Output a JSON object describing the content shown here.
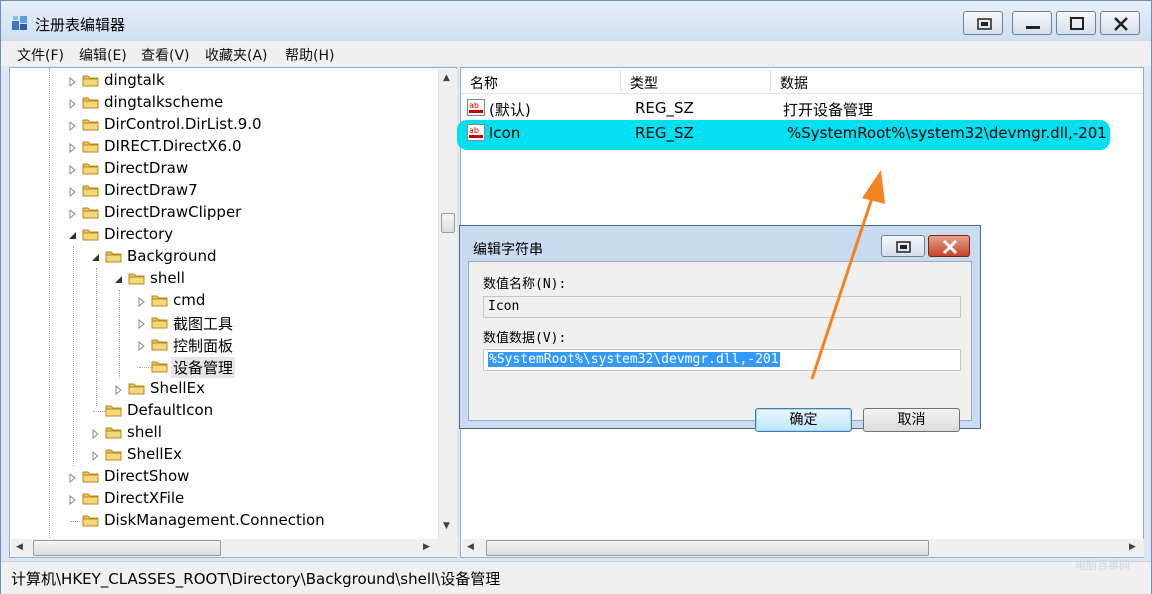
{
  "window": {
    "title": "注册表编辑器",
    "menu": [
      "文件(F)",
      "编辑(E)",
      "查看(V)",
      "收藏夹(A)",
      "帮助(H)"
    ]
  },
  "tree": {
    "items": [
      {
        "label": "dingtalk",
        "depth": 0,
        "expander": "collapsed"
      },
      {
        "label": "dingtalkscheme",
        "depth": 0,
        "expander": "collapsed"
      },
      {
        "label": "DirControl.DirList.9.0",
        "depth": 0,
        "expander": "collapsed"
      },
      {
        "label": "DIRECT.DirectX6.0",
        "depth": 0,
        "expander": "collapsed"
      },
      {
        "label": "DirectDraw",
        "depth": 0,
        "expander": "collapsed"
      },
      {
        "label": "DirectDraw7",
        "depth": 0,
        "expander": "collapsed"
      },
      {
        "label": "DirectDrawClipper",
        "depth": 0,
        "expander": "collapsed"
      },
      {
        "label": "Directory",
        "depth": 0,
        "expander": "expanded"
      },
      {
        "label": "Background",
        "depth": 1,
        "expander": "expanded"
      },
      {
        "label": "shell",
        "depth": 2,
        "expander": "expanded"
      },
      {
        "label": "cmd",
        "depth": 3,
        "expander": "collapsed"
      },
      {
        "label": "截图工具",
        "depth": 3,
        "expander": "collapsed"
      },
      {
        "label": "控制面板",
        "depth": 3,
        "expander": "collapsed"
      },
      {
        "label": "设备管理",
        "depth": 3,
        "expander": "none",
        "selected": true
      },
      {
        "label": "ShellEx",
        "depth": 2,
        "expander": "collapsed"
      },
      {
        "label": "DefaultIcon",
        "depth": 1,
        "expander": "none"
      },
      {
        "label": "shell",
        "depth": 1,
        "expander": "collapsed"
      },
      {
        "label": "ShellEx",
        "depth": 1,
        "expander": "collapsed"
      },
      {
        "label": "DirectShow",
        "depth": 0,
        "expander": "collapsed"
      },
      {
        "label": "DirectXFile",
        "depth": 0,
        "expander": "collapsed"
      },
      {
        "label": "DiskManagement.Connection",
        "depth": 0,
        "expander": "none"
      }
    ]
  },
  "list": {
    "headers": {
      "name": "名称",
      "type": "类型",
      "data": "数据"
    },
    "rows": [
      {
        "name": "(默认)",
        "type": "REG_SZ",
        "data": "打开设备管理",
        "icon": "string-value-icon"
      },
      {
        "name": "Icon",
        "type": "REG_SZ",
        "data": "%SystemRoot%\\system32\\devmgr.dll,-201",
        "icon": "string-value-icon",
        "highlighted": true
      }
    ],
    "highlight_color": "#00e0f0"
  },
  "status": {
    "path": "计算机\\HKEY_CLASSES_ROOT\\Directory\\Background\\shell\\设备管理"
  },
  "dialog": {
    "title": "编辑字符串",
    "name_label": "数值名称(N):",
    "name_value": "Icon",
    "data_label": "数值数据(V):",
    "data_value": "%SystemRoot%\\system32\\devmgr.dll,-201",
    "ok_label": "确定",
    "cancel_label": "取消"
  },
  "annotation": {
    "arrow_color": "#f58220"
  },
  "watermark": {
    "text": "电脑百事网"
  }
}
